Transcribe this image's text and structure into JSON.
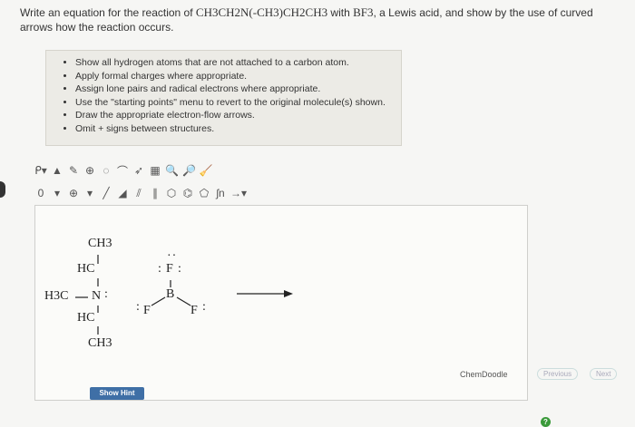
{
  "question": {
    "intro": "Write an equation for the reaction of ",
    "formula": "CH3CH2N(-CH3)CH2CH3",
    "with": " with ",
    "reagent": "BF3",
    "tail": ", a Lewis acid, and show by the use of curved arrows how the reaction occurs."
  },
  "instructions": [
    "Show all hydrogen atoms that are not attached to a carbon atom.",
    "Apply formal charges where appropriate.",
    "Assign lone pairs and radical electrons where appropriate.",
    "Use the \"starting points\" menu to revert to the original molecule(s) shown.",
    "Draw the appropriate electron-flow arrows.",
    "Omit + signs between structures."
  ],
  "toolbar": {
    "row1": [
      "lasso-icon",
      "eraser-icon",
      "pencil-icon",
      "add-icon",
      "ring-icon",
      "bond-icon",
      "arrow-icon",
      "template-icon",
      "zoom-in-icon",
      "zoom-out-icon",
      "clear-icon"
    ],
    "row2_charge": "0",
    "row2_plus": "⊕"
  },
  "molecule": {
    "top_ch3": "CH3",
    "hc_upper": "HC",
    "h3c": "H3C",
    "n": "N",
    "hc_lower": "HC",
    "bottom_ch3": "CH3",
    "bf3_f_top": "F",
    "bf3_b": "B",
    "bf3_f_left": "F",
    "bf3_f_right": "F"
  },
  "labels": {
    "chemdoodle": "ChemDoodle",
    "show_hint": "Show Hint",
    "previous": "Previous",
    "next": "Next",
    "help": "?"
  },
  "colors": {
    "help": "#3a9a3a",
    "hint_button": "#3f6fa6"
  }
}
